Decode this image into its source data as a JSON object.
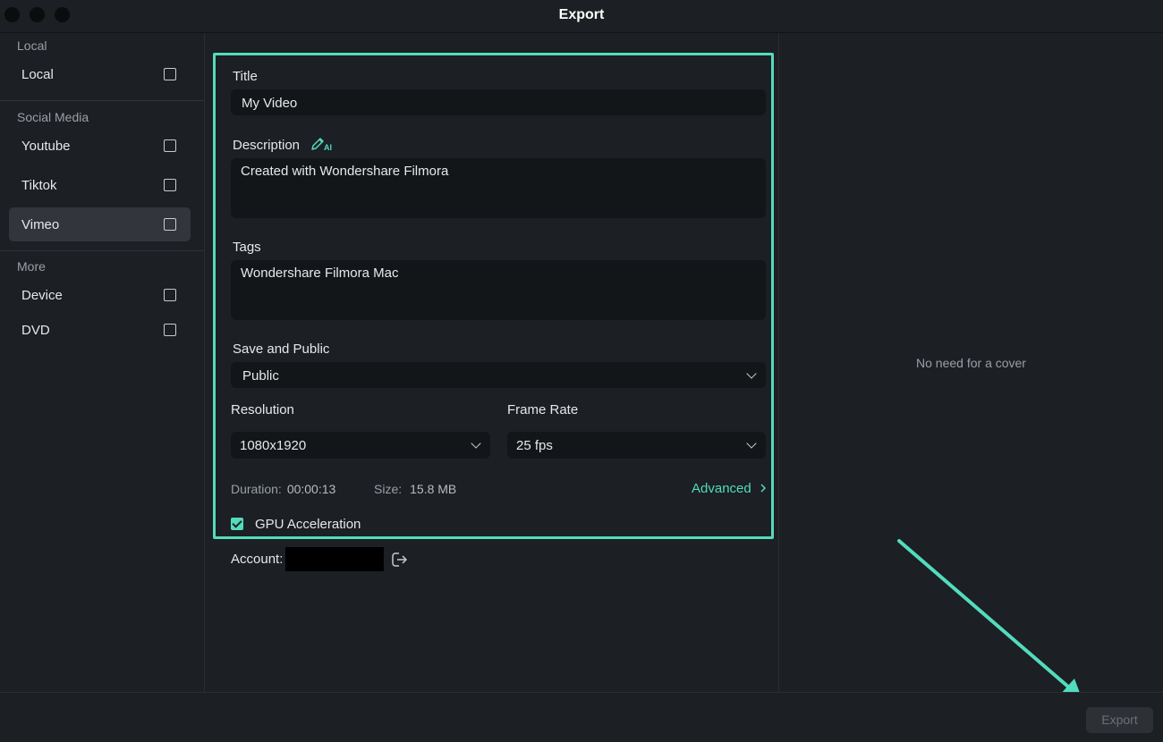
{
  "window": {
    "title": "Export"
  },
  "sidebar": {
    "sections": [
      {
        "label": "Local",
        "items": [
          {
            "label": "Local",
            "checked": false
          }
        ]
      },
      {
        "label": "Social Media",
        "items": [
          {
            "label": "Youtube",
            "checked": false
          },
          {
            "label": "Tiktok",
            "checked": false
          },
          {
            "label": "Vimeo",
            "checked": false,
            "selected": true
          }
        ]
      },
      {
        "label": "More",
        "items": [
          {
            "label": "Device",
            "checked": false
          },
          {
            "label": "DVD",
            "checked": false
          }
        ]
      }
    ]
  },
  "form": {
    "title_label": "Title",
    "title_value": "My Video",
    "description_label": "Description",
    "description_ai_icon": "pencil-ai-icon",
    "description_value": "Created with Wondershare Filmora",
    "tags_label": "Tags",
    "tags_value": "Wondershare Filmora Mac",
    "privacy_label": "Save and Public",
    "privacy_value": "Public",
    "resolution_label": "Resolution",
    "resolution_value": "1080x1920",
    "framerate_label": "Frame Rate",
    "framerate_value": "25 fps",
    "duration_label": "Duration:",
    "duration_value": "00:00:13",
    "size_label": "Size:",
    "size_value": "15.8 MB",
    "advanced_label": "Advanced",
    "gpu_label": "GPU Acceleration",
    "gpu_checked": true,
    "account_label": "Account:"
  },
  "cover": {
    "text": "No need for a cover"
  },
  "footer": {
    "export_label": "Export"
  },
  "colors": {
    "accent": "#52dcbd",
    "background": "#1c1f23",
    "input": "#131619"
  }
}
